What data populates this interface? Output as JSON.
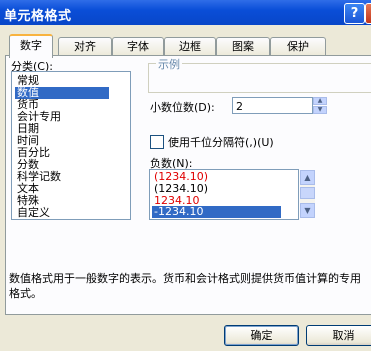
{
  "window": {
    "title": "单元格格式"
  },
  "tabs": [
    {
      "label": "数字"
    },
    {
      "label": "对齐"
    },
    {
      "label": "字体"
    },
    {
      "label": "边框"
    },
    {
      "label": "图案"
    },
    {
      "label": "保护"
    }
  ],
  "category": {
    "label": "分类(C):",
    "items": [
      "常规",
      "数值",
      "货币",
      "会计专用",
      "日期",
      "时间",
      "百分比",
      "分数",
      "科学记数",
      "文本",
      "特殊",
      "自定义"
    ],
    "selected": "数值"
  },
  "sample": {
    "legend": "示例"
  },
  "decimal_places": {
    "label": "小数位数(D):",
    "value": "2"
  },
  "thousands_separator": {
    "label": "使用千位分隔符(,)(U)",
    "checked": false
  },
  "negative_numbers": {
    "label": "负数(N):",
    "items": [
      "(1234.10)",
      "(1234.10)",
      "1234.10",
      "-1234.10"
    ],
    "item_colors": [
      "#e00000",
      "#000000",
      "#e00000",
      "#ffffff"
    ],
    "selected_index": 3
  },
  "description": "数值格式用于一般数字的表示。货币和会计格式则提供货币值计算的专用格式。",
  "buttons": {
    "ok": "确定",
    "cancel": "取消"
  },
  "colors": {
    "titlebar": "#0a4ed8",
    "selection": "#316ac5",
    "negative_red": "#e00000"
  }
}
